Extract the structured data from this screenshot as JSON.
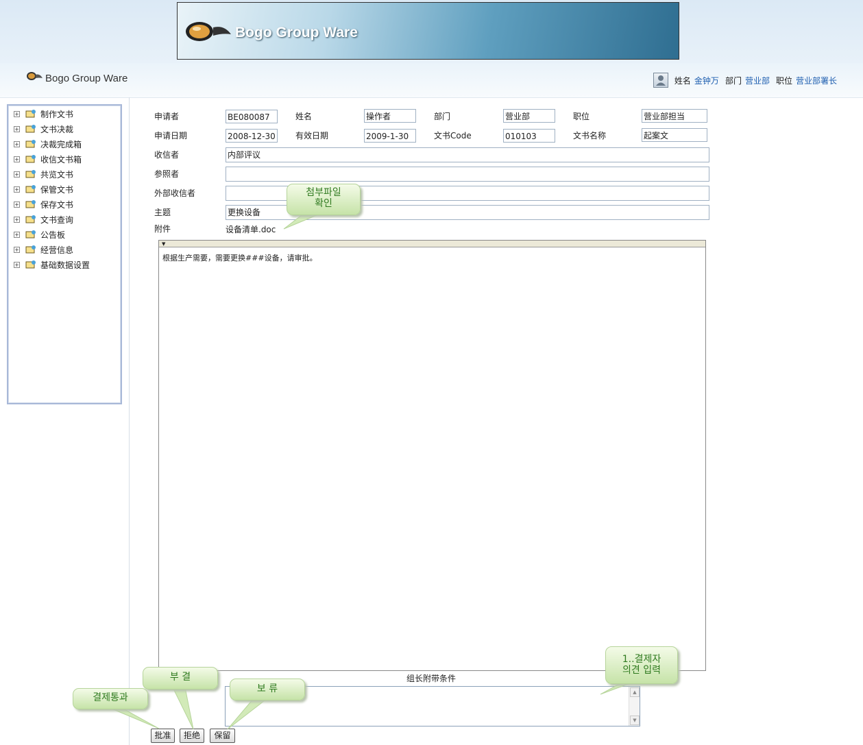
{
  "banner": {
    "title": "Bogo Group Ware"
  },
  "subheader": {
    "title": "Bogo Group Ware"
  },
  "user": {
    "name_label": "姓名",
    "name": "金钟万",
    "dept_label": "部门",
    "dept": "营业部",
    "position_label": "职位",
    "position": "营业部署长"
  },
  "sidebar": {
    "items": [
      {
        "label": "制作文书"
      },
      {
        "label": "文书决裁"
      },
      {
        "label": "决裁完成箱"
      },
      {
        "label": "收信文书箱"
      },
      {
        "label": "共览文书"
      },
      {
        "label": "保管文书"
      },
      {
        "label": "保存文书"
      },
      {
        "label": "文书查询"
      },
      {
        "label": "公告板"
      },
      {
        "label": "经营信息"
      },
      {
        "label": "基础数据设置"
      }
    ]
  },
  "form": {
    "applicant_label": "申请者",
    "applicant": "BE080087",
    "name_label": "姓名",
    "name": "操作者",
    "dept_label": "部门",
    "dept": "营业部",
    "position_label": "职位",
    "position": "营业部担当",
    "apply_date_label": "申请日期",
    "apply_date": "2008-12-30",
    "valid_date_label": "有效日期",
    "valid_date": "2009-1-30",
    "doc_code_label": "文书Code",
    "doc_code": "010103",
    "doc_name_label": "文书名称",
    "doc_name": "起案文",
    "receiver_label": "收信者",
    "receiver": "内部评议",
    "reference_label": "参照者",
    "reference": "",
    "external_label": "外部收信者",
    "external": "",
    "subject_label": "主题",
    "subject": "更换设备",
    "attach_label": "附件",
    "attach": "设备清单.doc"
  },
  "editor": {
    "content": "根据生产需要，需要更换###设备，请审批。"
  },
  "opinion": {
    "label": "组长附带条件",
    "value": ""
  },
  "buttons": {
    "approve": "批准",
    "reject": "拒绝",
    "hold": "保留"
  },
  "callouts": {
    "attach_line1": "첨부파일",
    "attach_line2": "확인",
    "opinion_line1": "1..결제자",
    "opinion_line2": "의견 입력",
    "approve": "결제통과",
    "reject": "부  결",
    "hold": "보  류"
  }
}
